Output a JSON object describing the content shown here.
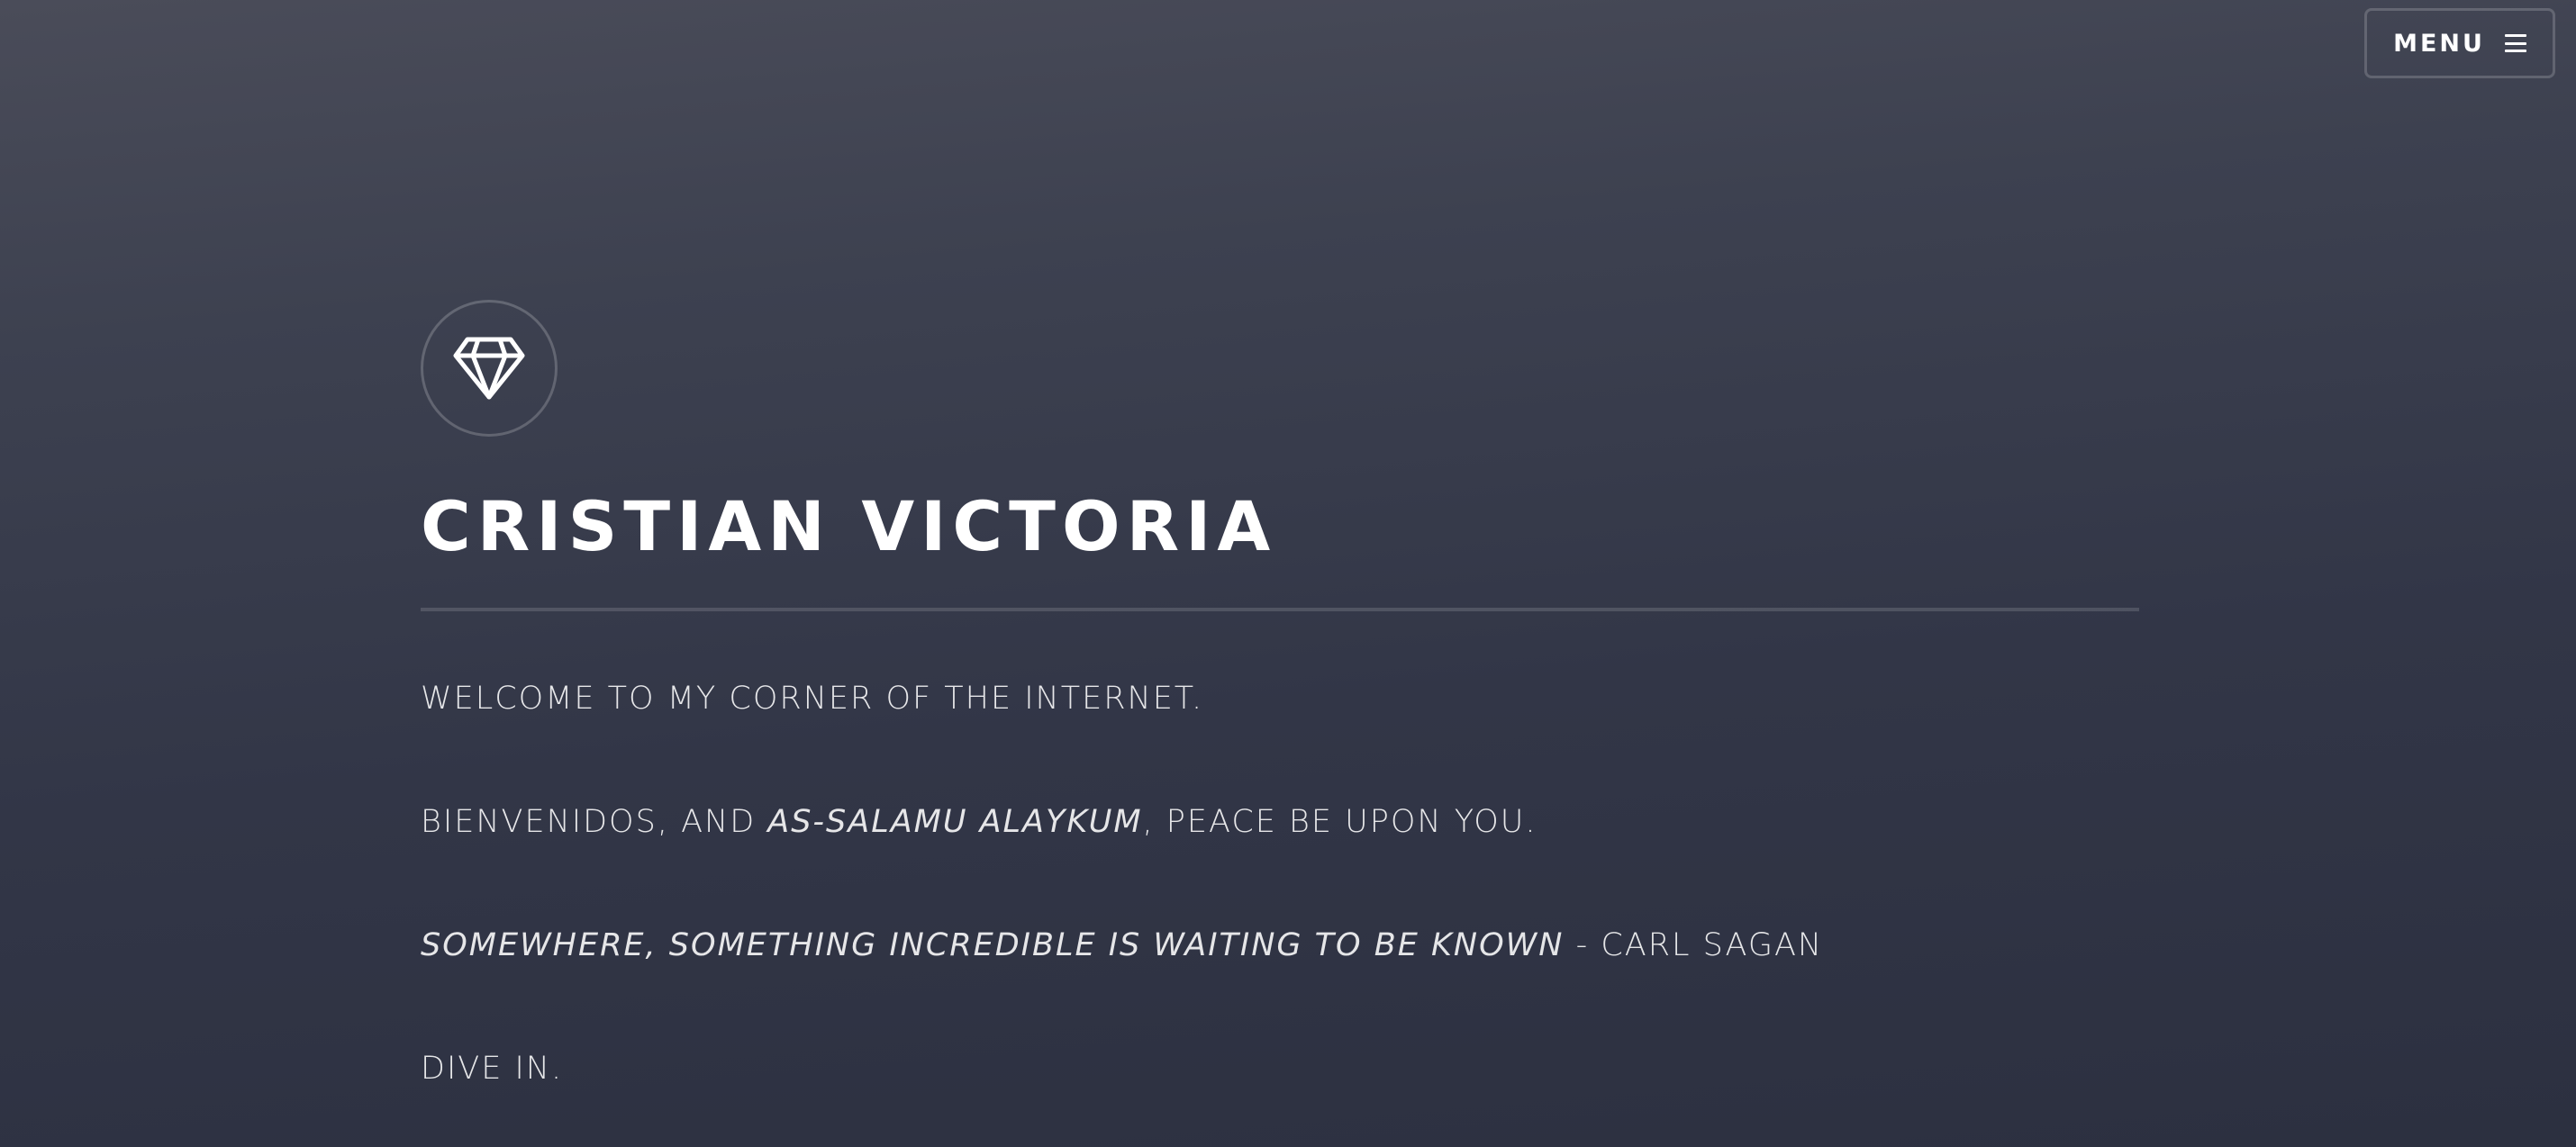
{
  "nav": {
    "menu_label": "MENU",
    "menu_icon": "hamburger-icon"
  },
  "header": {
    "logo_icon": "diamond-icon",
    "title": "CRISTIAN VICTORIA"
  },
  "intro": {
    "line1": "WELCOME TO MY CORNER OF THE INTERNET.",
    "line2_prefix": "BIENVENIDOS, AND ",
    "line2_italic": "AS-SALAMU ALAYKUM",
    "line2_suffix": ", PEACE BE UPON YOU.",
    "quote_text": "SOMEWHERE, SOMETHING INCREDIBLE IS WAITING TO BE KNOWN",
    "quote_author": " - CARL SAGAN",
    "line4": "DIVE IN."
  },
  "colors": {
    "background_top": "#4a4c59",
    "background_bottom": "#2c3040",
    "text": "#ffffff"
  }
}
